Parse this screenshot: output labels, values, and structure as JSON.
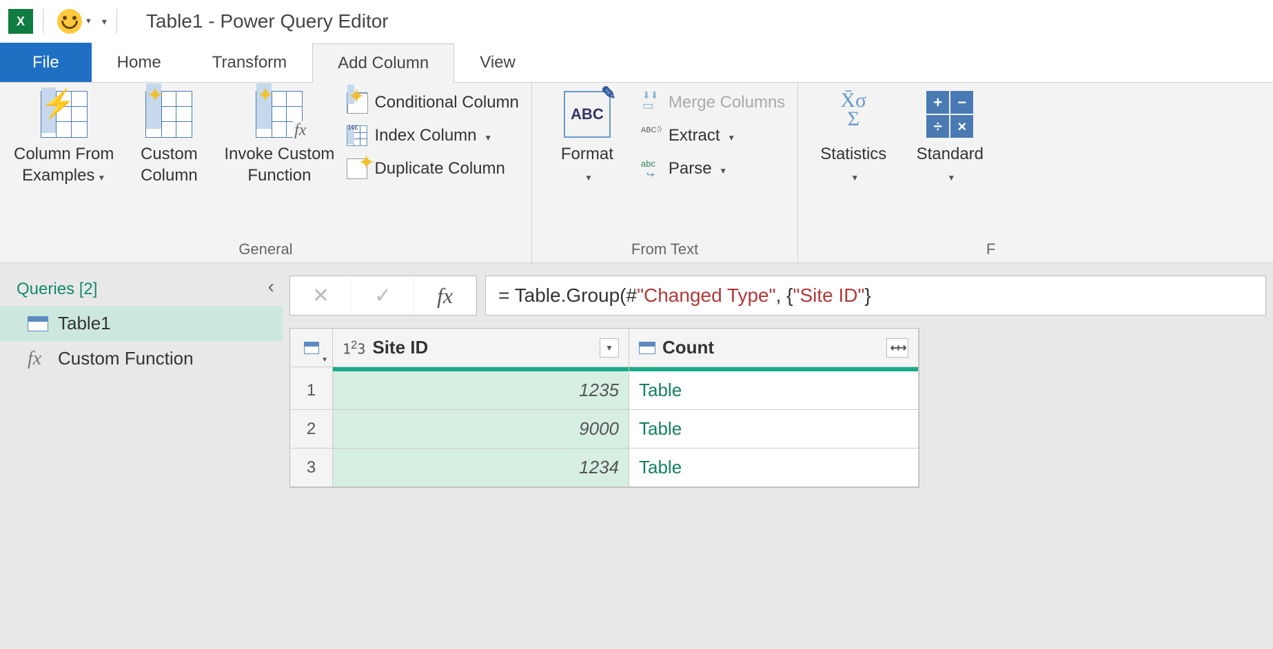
{
  "title": "Table1 - Power Query Editor",
  "tabs": {
    "file": "File",
    "home": "Home",
    "transform": "Transform",
    "add_column": "Add Column",
    "view": "View"
  },
  "ribbon": {
    "general": {
      "label": "General",
      "col_from_examples": "Column From\nExamples",
      "custom_column": "Custom\nColumn",
      "invoke_custom": "Invoke Custom\nFunction",
      "conditional": "Conditional Column",
      "index": "Index Column",
      "duplicate": "Duplicate Column"
    },
    "from_text": {
      "label": "From Text",
      "format": "Format",
      "merge": "Merge Columns",
      "extract": "Extract",
      "parse": "Parse"
    },
    "from_number_partial": {
      "statistics": "Statistics",
      "standard": "Standard",
      "group_label_partial": "F"
    }
  },
  "queries": {
    "header": "Queries [2]",
    "items": [
      {
        "name": "Table1",
        "type": "table",
        "selected": true
      },
      {
        "name": "Custom Function",
        "type": "fx",
        "selected": false
      }
    ]
  },
  "formula": {
    "prefix": "= Table.Group(#",
    "str1": "\"Changed Type\"",
    "mid1": ", {",
    "str2": "\"Site ID\"",
    "suffix": "}"
  },
  "grid": {
    "columns": [
      {
        "name": "Site ID",
        "type": "number"
      },
      {
        "name": "Count",
        "type": "table"
      }
    ],
    "rows": [
      {
        "n": "1",
        "site_id": "1235",
        "count": "Table"
      },
      {
        "n": "2",
        "site_id": "9000",
        "count": "Table"
      },
      {
        "n": "3",
        "site_id": "1234",
        "count": "Table"
      }
    ]
  }
}
